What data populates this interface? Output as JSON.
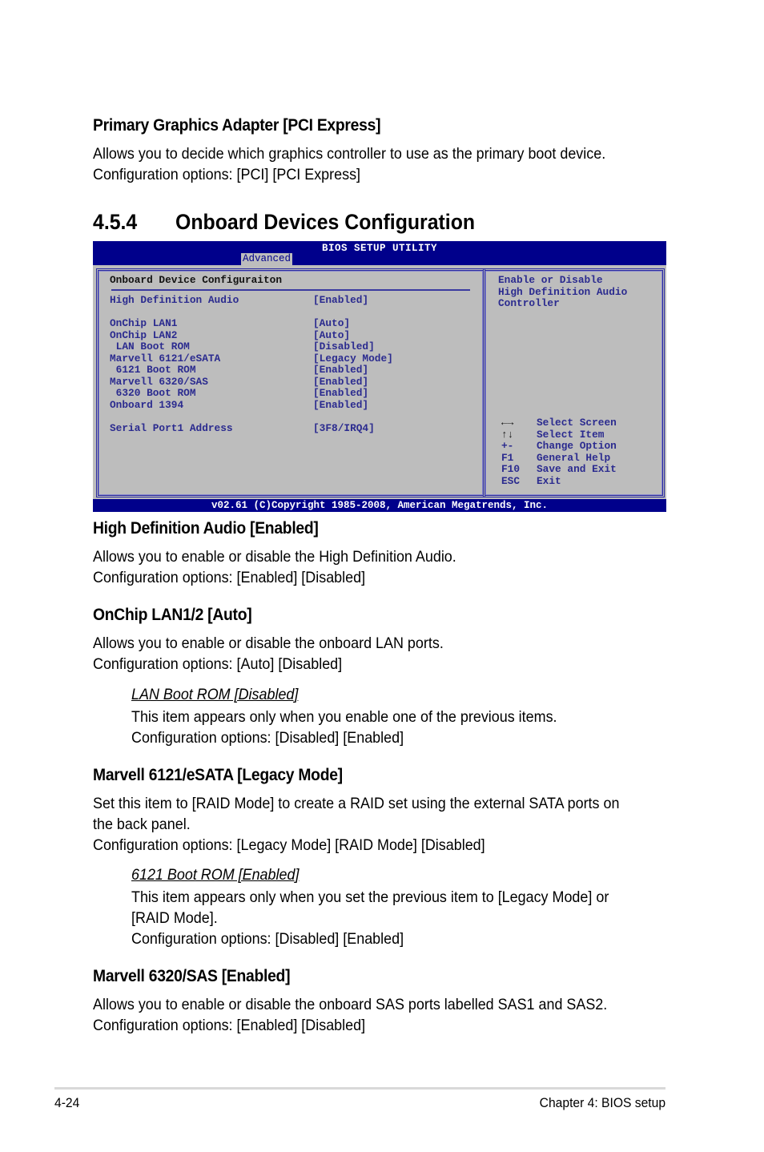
{
  "sections": {
    "primary_graphics": {
      "title": "Primary Graphics Adapter [PCI Express]",
      "line1": "Allows you to decide which graphics controller to use as the primary boot device.",
      "line2": "Configuration options: [PCI] [PCI Express]"
    },
    "heading": {
      "number": "4.5.4",
      "title": "Onboard Devices Configuration"
    },
    "hd_audio": {
      "title": "High Definition Audio [Enabled]",
      "line1": "Allows you to enable or disable the High Definition Audio.",
      "line2": "Configuration options: [Enabled] [Disabled]"
    },
    "onchip_lan": {
      "title": "OnChip LAN1/2 [Auto]",
      "line1": "Allows you to enable or disable the onboard LAN ports.",
      "line2": "Configuration options: [Auto] [Disabled]",
      "sub_title": "LAN Boot ROM [Disabled]",
      "sub_line1": "This item appears only when you enable one of the previous items.",
      "sub_line2": "Configuration options: [Disabled] [Enabled]"
    },
    "marvell_6121": {
      "title": "Marvell 6121/eSATA [Legacy Mode]",
      "line1": "Set this item to [RAID Mode] to create a RAID set using the external SATA ports on",
      "line2": "the back panel.",
      "line3": "Configuration options: [Legacy Mode] [RAID Mode] [Disabled]",
      "sub_title": "6121 Boot ROM [Enabled]",
      "sub_line1": "This item appears only when you set the previous item to [Legacy Mode] or",
      "sub_line2": "[RAID Mode].",
      "sub_line3": "Configuration options: [Disabled] [Enabled]"
    },
    "marvell_6320": {
      "title": "Marvell 6320/SAS [Enabled]",
      "line1": "Allows you to enable or disable the onboard SAS ports labelled SAS1 and SAS2.",
      "line2": "Configuration options: [Enabled] [Disabled]"
    }
  },
  "bios": {
    "title": "BIOS SETUP UTILITY",
    "active_tab": "Advanced",
    "panel_heading": "Onboard Device Configuraiton",
    "items": [
      {
        "label": "High Definition Audio",
        "value": "[Enabled]"
      },
      {
        "label": "OnChip LAN1",
        "value": "[Auto]"
      },
      {
        "label": "OnChip LAN2",
        "value": "[Auto]"
      },
      {
        "label": " LAN Boot ROM",
        "value": "[Disabled]"
      },
      {
        "label": "Marvell 6121/eSATA",
        "value": "[Legacy Mode]"
      },
      {
        "label": " 6121 Boot ROM",
        "value": "[Enabled]"
      },
      {
        "label": "Marvell 6320/SAS",
        "value": "[Enabled]"
      },
      {
        "label": " 6320 Boot ROM",
        "value": "[Enabled]"
      },
      {
        "label": "Onboard 1394",
        "value": "[Enabled]"
      },
      {
        "label": "Serial Port1 Address",
        "value": "[3F8/IRQ4]"
      }
    ],
    "help": [
      "Enable or Disable",
      "High Definition Audio",
      "Controller"
    ],
    "keys": [
      {
        "key": "←→",
        "icon": "left-right-arrows-icon",
        "action": "Select Screen"
      },
      {
        "key": "↑↓",
        "icon": "up-down-arrows-icon",
        "action": "Select Item"
      },
      {
        "key": "+-",
        "action": "Change Option"
      },
      {
        "key": "F1",
        "action": "General Help"
      },
      {
        "key": "F10",
        "action": "Save and Exit"
      },
      {
        "key": "ESC",
        "action": "Exit"
      }
    ],
    "copyright": "v02.61 (C)Copyright 1985-2008, American Megatrends, Inc."
  },
  "footer": {
    "page": "4-24",
    "chapter": "Chapter 4: BIOS setup"
  }
}
